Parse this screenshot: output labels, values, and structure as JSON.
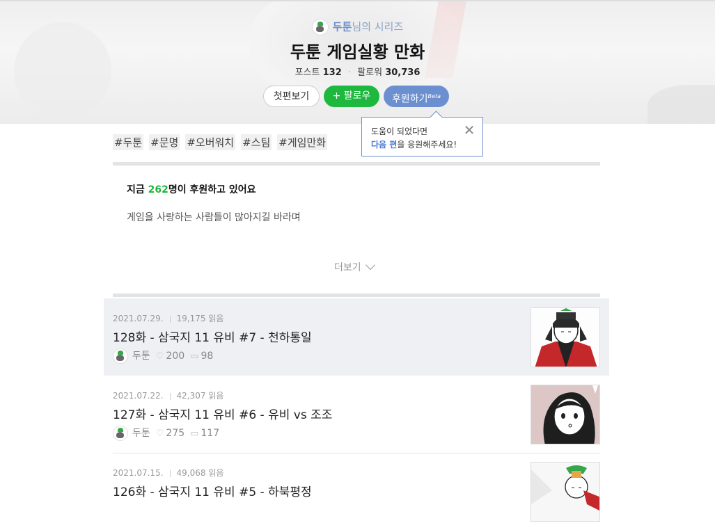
{
  "header": {
    "author_name": "두툰",
    "author_suffix": "님의 시리즈",
    "series_title": "두툰 게임실황 만화",
    "posts_label": "포스트",
    "posts_count": "132",
    "followers_label": "팔로워",
    "followers_count": "30,736"
  },
  "buttons": {
    "first_view": "첫편보기",
    "follow": "+ 팔로우",
    "support": "후원하기",
    "support_badge": "Beta"
  },
  "tooltip": {
    "line1": "도움이 되었다면",
    "highlight": "다음 편",
    "line2_rest": "을 응원해주세요!",
    "close": "✕"
  },
  "tags": [
    "#두툰",
    "#문명",
    "#오버워치",
    "#스팀",
    "#게임만화"
  ],
  "support_box": {
    "prefix": "지금 ",
    "count": "262",
    "suffix": "명이 후원하고 있어요",
    "message": "게임을 사랑하는 사람들이 많아지길 바라며",
    "more": "더보기"
  },
  "posts": [
    {
      "date": "2021.07.29.",
      "views": "19,175 읽음",
      "title": "128화 - 삼국지 11 유비 #7 - 천하통일",
      "author": "두툰",
      "likes": "200",
      "comments": "98"
    },
    {
      "date": "2021.07.22.",
      "views": "42,307 읽음",
      "title": "127화 - 삼국지 11 유비 #6 - 유비 vs 조조",
      "author": "두툰",
      "likes": "275",
      "comments": "117"
    },
    {
      "date": "2021.07.15.",
      "views": "49,068 읽음",
      "title": "126화 - 삼국지 11 유비 #5 - 하북평정",
      "author": "두툰",
      "likes": "",
      "comments": ""
    }
  ]
}
